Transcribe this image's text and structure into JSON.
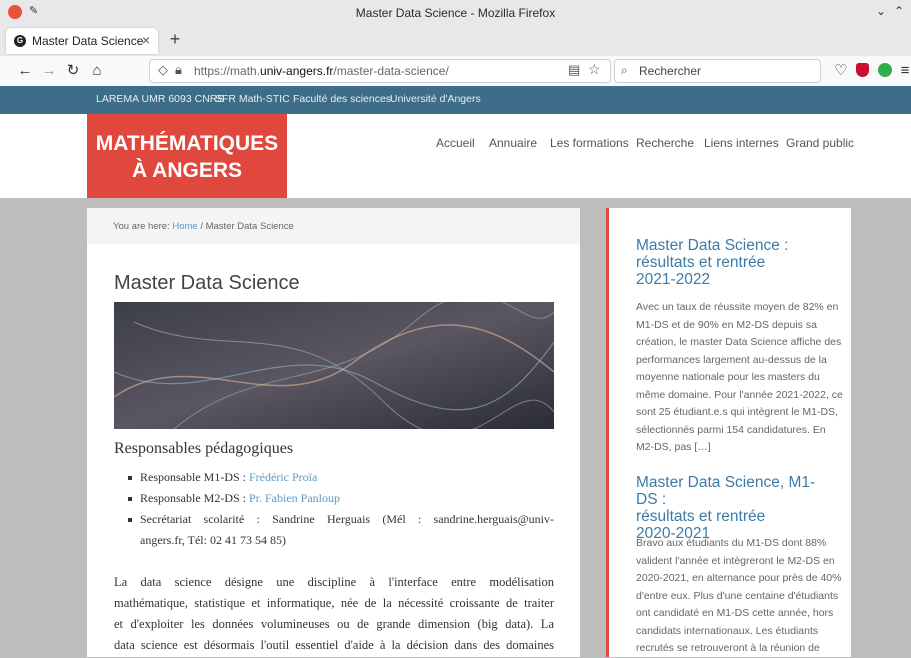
{
  "window": {
    "title": "Master Data Science - Mozilla Firefox"
  },
  "browser": {
    "tab_label": "Master Data Science",
    "tab_close": "×",
    "new_tab": "+",
    "url_prefix": "https://math.",
    "url_domain": "univ-angers.fr",
    "url_path": "/master-data-science/",
    "search_placeholder": "Rechercher"
  },
  "site": {
    "top_links": [
      "LAREMA UMR 6093 CNRS",
      "SFR Math-STIC",
      "Faculté des sciences",
      "Université d'Angers"
    ],
    "logo_line1": "MATHÉMATIQUES",
    "logo_line2": "À ANGERS",
    "menu": [
      "Accueil",
      "Annuaire",
      "Les formations",
      "Recherche",
      "Liens internes",
      "Grand public"
    ],
    "breadcrumb_prefix": "You are here: ",
    "breadcrumb_home": "Home",
    "breadcrumb_rest": " / Master Data Science",
    "page_title": "Master Data Science",
    "resp_title": "Responsables pédagogiques",
    "resp": [
      {
        "prefix": "Responsable M1-DS : ",
        "link": "Frédéric Proïa"
      },
      {
        "prefix": "Responsable M2-DS : ",
        "link": "Pr. Fabien Panloup"
      }
    ],
    "secretariat_line1": "Secrétariat scolarité : Sandrine Herguais (Mél : sandrine.herguais@univ-",
    "secretariat_line2": "angers.fr, Tél: 02 41 73 54 85)",
    "paragraph": [
      "La data science désigne une discipline à l'interface entre modélisation",
      "mathématique, statistique et informatique, née de la nécessité croissante de traiter",
      "et d'exploiter les données volumineuses ou de grande dimension (big data). La",
      "data science est désormais l'outil essentiel d'aide à la décision dans des domaines"
    ],
    "sidebar": [
      {
        "title_lines": [
          "Master Data Science :",
          "résultats et rentrée",
          "2021-2022"
        ],
        "text_lines": [
          "Avec un taux de réussite moyen de 82% en",
          "M1-DS et de 90% en M2-DS depuis sa",
          "création, le master Data Science affiche des",
          "performances largement au-dessus de la",
          "moyenne nationale pour les masters du",
          "même domaine. Pour l'année 2021-2022, ce",
          "sont 25 étudiant.e.s qui intègrent le M1-DS,",
          "sélectionnés parmi 154 candidatures. En",
          "M2-DS, pas […]"
        ]
      },
      {
        "title_lines": [
          "Master Data Science, M1-DS :",
          "résultats et rentrée",
          "2020-2021"
        ],
        "text_lines": [
          "Bravo aux étudiants du M1-DS dont 88%",
          "valident l'année et intègreront le M2-DS en",
          "2020-2021, en alternance pour près de 40%",
          "d'entre eux. Plus d'une centaine d'étudiants",
          "ont candidaté en M1-DS cette année, hors",
          "candidats internationaux. Les étudiants",
          "recrutés se retrouveront à la réunion de"
        ]
      }
    ]
  }
}
